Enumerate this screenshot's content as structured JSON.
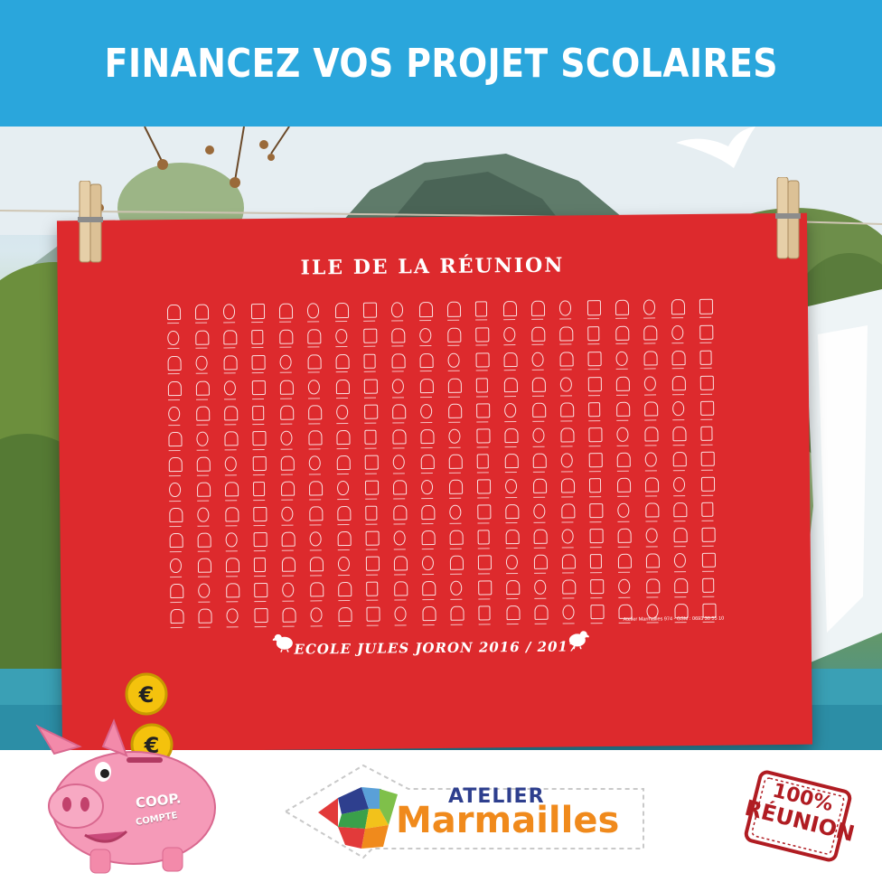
{
  "banner": {
    "title": "FINANCEZ VOS PROJET SCOLAIRES",
    "color": "#2aa6dc"
  },
  "towel": {
    "title": "ILE DE LA RÉUNION",
    "school": "ECOLE JULES JORON 2016 / 2017",
    "contact": "Atelier Marmailles 974 - GSM : 0693 30 55 10",
    "color": "#dd2a2d"
  },
  "piggy_bank": {
    "coin_symbol": "€",
    "label": "COOP.",
    "sub_label": "COMPTE"
  },
  "logo": {
    "line1": "ATELIER",
    "line2": "Marmailles"
  },
  "stamp": {
    "line1": "100%",
    "line2": "RÉUNION"
  }
}
